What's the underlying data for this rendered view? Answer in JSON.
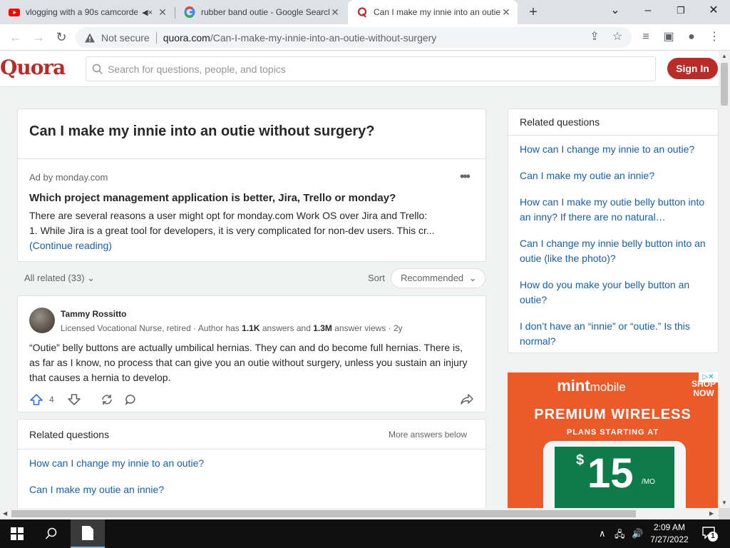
{
  "browser": {
    "tabs": [
      {
        "title": "vlogging with a 90s camcorder",
        "icon": "youtube-icon",
        "muted_icon": "speaker-mute-icon"
      },
      {
        "title": "rubber band outie - Google Search",
        "icon": "google-icon"
      },
      {
        "title": "Can I make my innie into an outie",
        "icon": "quora-icon",
        "active": true
      }
    ],
    "new_tab": "+",
    "window_controls": {
      "tab_search": "⌄",
      "minimize": "–",
      "restore": "❐",
      "close": "✕"
    },
    "address": {
      "security": "Not secure",
      "url_domain": "quora.com",
      "url_path": "/Can-I-make-my-innie-into-an-outie-without-surgery"
    }
  },
  "quora": {
    "logo": "Quora",
    "search_placeholder": "Search for questions, people, and topics",
    "signin": "Sign In",
    "question_title": "Can I make my innie into an outie without surgery?",
    "ad": {
      "by": "Ad by monday.com",
      "more": "•••",
      "title": "Which project management application is better, Jira, Trello or monday?",
      "line1": "There are several reasons a user might opt for monday.com Work OS over Jira and Trello:",
      "line2": "1. While Jira is a great tool for developers, it is very complicated for non-dev users. This cr...",
      "continue": "(Continue reading)"
    },
    "all_related": "All related (33)",
    "sort_label": "Sort",
    "sort_value": "Recommended",
    "answer": {
      "author": "Tammy Rossitto",
      "cred_pre": "Licensed Vocational Nurse, retired · Author has ",
      "answers_count": "1.1K",
      "cred_mid": " answers and ",
      "views_count": "1.3M",
      "cred_post": " answer views · 2y",
      "text": "“Outie” belly buttons are actually umbilical hernias. They can and do become full hernias. There is, as far as I know, no process that can give you an outie without surgery, unless you sustain an injury that causes a hernia to develop.",
      "upvotes": "4"
    },
    "related_bottom": {
      "header": "Related questions",
      "more": "More answers below",
      "items": [
        "How can I change my innie to an outie?",
        "Can I make my outie an innie?"
      ]
    },
    "related_side": {
      "header": "Related questions",
      "items": [
        "How can I change my innie to an outie?",
        "Can I make my outie an innie?",
        "How can I make my outie belly button into an inny? If there are no natural…",
        "Can I change my innie belly button into an outie (like the photo)?",
        "How do you make your belly button an outie?",
        "I don’t have an “innie” or “outie.” Is this normal?"
      ]
    },
    "side_ad": {
      "brand_bold": "mint",
      "brand_rest": "mobile",
      "headline": "PREMIUM WIRELESS",
      "sub": "PLANS STARTING AT",
      "dollar": "$",
      "price": "15",
      "per": "/MO",
      "shop": "SHOP NOW"
    }
  },
  "taskbar": {
    "time": "2:09 AM",
    "date": "7/27/2022",
    "notifications": "1"
  }
}
